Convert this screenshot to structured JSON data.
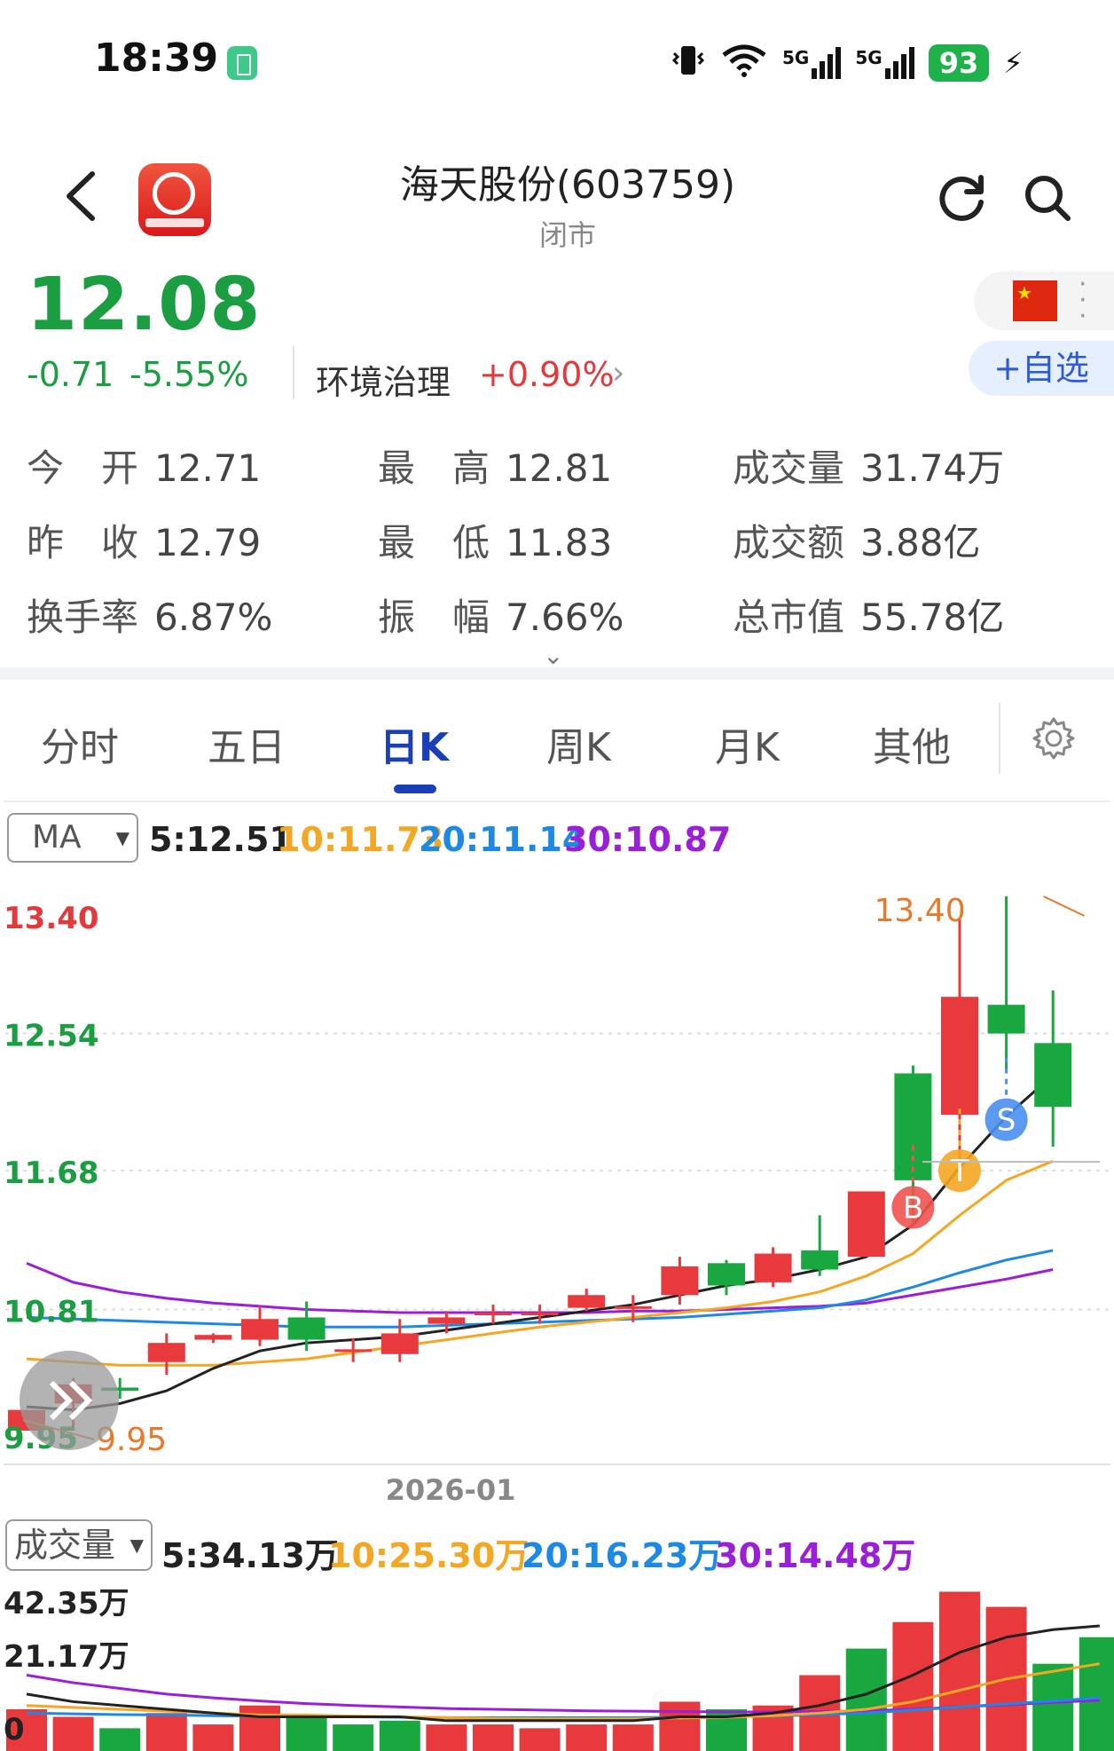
{
  "status_bar": {
    "time": "18:39",
    "battery": "93",
    "signal1": "5G",
    "signal2": "5G"
  },
  "header": {
    "title": "海天股份(603759)",
    "market_status": "闭市"
  },
  "quote": {
    "price": "12.08",
    "change": "-0.71",
    "change_pct": "-5.55%",
    "sector": "环境治理",
    "sector_pct": "+0.90%",
    "add_watch": "+自选"
  },
  "stats": [
    {
      "label": "今　开",
      "value": "12.71"
    },
    {
      "label": "最　高",
      "value": "12.81"
    },
    {
      "label": "成交量",
      "value": "31.74万"
    },
    {
      "label": "昨　收",
      "value": "12.79"
    },
    {
      "label": "最　低",
      "value": "11.83"
    },
    {
      "label": "成交额",
      "value": "3.88亿"
    },
    {
      "label": "换手率",
      "value": "6.87%"
    },
    {
      "label": "振　幅",
      "value": "7.66%"
    },
    {
      "label": "总市值",
      "value": "55.78亿"
    }
  ],
  "tabs": [
    "分时",
    "五日",
    "日K",
    "周K",
    "月K",
    "其他"
  ],
  "active_tab": "日K",
  "ma_legend": {
    "selector": "MA",
    "ma5": "5:12.51",
    "ma10": "10:11.73",
    "ma20": "20:11.14",
    "ma30": "30:10.87"
  },
  "vol_legend": {
    "selector": "成交量",
    "ma5": "5:34.13万",
    "ma10": "10:25.30万",
    "ma20": "20:16.23万",
    "ma30": "30:14.48万"
  },
  "colors": {
    "up": "#e8393c",
    "down": "#18a83f",
    "ma5": "#222222",
    "ma10": "#f5a623",
    "ma20": "#1e88e5",
    "ma30": "#9b1fd8"
  },
  "chart_data": [
    {
      "type": "candlestick",
      "title": "",
      "y_axis_labels": [
        "13.40",
        "12.54",
        "11.68",
        "10.81",
        "9.95"
      ],
      "ylim": [
        9.95,
        13.4
      ],
      "x_label": "2026-01",
      "high_marker": "13.40",
      "low_marker": "9.95",
      "candles": [
        {
          "o": 10.05,
          "c": 10.18,
          "h": 10.18,
          "l": 10.05
        },
        {
          "o": 10.22,
          "c": 10.34,
          "h": 10.38,
          "l": 10.05
        },
        {
          "o": 10.32,
          "c": 10.3,
          "h": 10.38,
          "l": 10.25
        },
        {
          "o": 10.48,
          "c": 10.6,
          "h": 10.66,
          "l": 10.4
        },
        {
          "o": 10.62,
          "c": 10.65,
          "h": 10.66,
          "l": 10.6
        },
        {
          "o": 10.62,
          "c": 10.75,
          "h": 10.83,
          "l": 10.58
        },
        {
          "o": 10.76,
          "c": 10.62,
          "h": 10.86,
          "l": 10.55
        },
        {
          "o": 10.56,
          "c": 10.56,
          "h": 10.63,
          "l": 10.48
        },
        {
          "o": 10.53,
          "c": 10.66,
          "h": 10.75,
          "l": 10.48
        },
        {
          "o": 10.72,
          "c": 10.76,
          "h": 10.8,
          "l": 10.66
        },
        {
          "o": 10.79,
          "c": 10.79,
          "h": 10.84,
          "l": 10.72
        },
        {
          "o": 10.79,
          "c": 10.79,
          "h": 10.84,
          "l": 10.72
        },
        {
          "o": 10.82,
          "c": 10.9,
          "h": 10.94,
          "l": 10.8
        },
        {
          "o": 10.83,
          "c": 10.83,
          "h": 10.9,
          "l": 10.73
        },
        {
          "o": 10.9,
          "c": 11.08,
          "h": 11.14,
          "l": 10.84
        },
        {
          "o": 11.1,
          "c": 10.96,
          "h": 11.12,
          "l": 10.9
        },
        {
          "o": 10.98,
          "c": 11.16,
          "h": 11.2,
          "l": 10.95
        },
        {
          "o": 11.18,
          "c": 11.06,
          "h": 11.4,
          "l": 11.02
        },
        {
          "o": 11.14,
          "c": 11.55,
          "h": 11.55,
          "l": 11.14
        },
        {
          "o": 12.29,
          "c": 11.62,
          "h": 12.34,
          "l": 11.34
        },
        {
          "o": 12.03,
          "c": 12.77,
          "h": 13.26,
          "l": 11.68
        },
        {
          "o": 12.72,
          "c": 12.54,
          "h": 13.4,
          "l": 12.3
        },
        {
          "o": 12.48,
          "c": 12.08,
          "h": 12.81,
          "l": 11.83
        }
      ],
      "ma5": [
        10.2,
        10.18,
        10.22,
        10.3,
        10.44,
        10.55,
        10.6,
        10.62,
        10.64,
        10.68,
        10.72,
        10.76,
        10.8,
        10.84,
        10.9,
        10.96,
        11.0,
        11.06,
        11.14,
        11.34,
        11.7,
        12.02,
        12.28
      ],
      "ma10": [
        10.5,
        10.48,
        10.46,
        10.46,
        10.46,
        10.48,
        10.5,
        10.54,
        10.58,
        10.62,
        10.66,
        10.7,
        10.73,
        10.76,
        10.79,
        10.82,
        10.86,
        10.92,
        11.02,
        11.16,
        11.4,
        11.62,
        11.74
      ],
      "ma20": [
        10.76,
        10.75,
        10.74,
        10.73,
        10.72,
        10.71,
        10.7,
        10.7,
        10.7,
        10.71,
        10.72,
        10.73,
        10.74,
        10.75,
        10.76,
        10.78,
        10.8,
        10.82,
        10.87,
        10.95,
        11.04,
        11.12,
        11.18
      ],
      "ma30": [
        11.1,
        10.98,
        10.92,
        10.88,
        10.85,
        10.83,
        10.81,
        10.8,
        10.79,
        10.79,
        10.79,
        10.79,
        10.79,
        10.8,
        10.8,
        10.81,
        10.82,
        10.83,
        10.85,
        10.9,
        10.95,
        11.0,
        11.06
      ],
      "signals": [
        {
          "label": "B",
          "candle": 19,
          "value": 11.45,
          "color": "#ef5350"
        },
        {
          "label": "T",
          "candle": 20,
          "value": 11.68,
          "color": "#f5a623"
        },
        {
          "label": "S",
          "candle": 21,
          "value": 12.0,
          "color": "#4a8ef0"
        }
      ]
    },
    {
      "type": "bar",
      "title": "成交量",
      "y_axis_labels": [
        "42.35万",
        "21.17万",
        "0"
      ],
      "ylim": [
        0,
        42.35
      ],
      "unit": "万",
      "values": [
        11,
        9,
        6,
        10,
        7,
        12,
        9,
        7,
        8,
        7,
        7,
        6,
        7,
        7,
        13,
        11,
        12,
        20,
        27,
        34,
        42,
        38,
        23,
        30
      ],
      "direction": [
        "up",
        "up",
        "down",
        "up",
        "up",
        "up",
        "down",
        "down",
        "down",
        "up",
        "up",
        "up",
        "up",
        "up",
        "up",
        "down",
        "up",
        "up",
        "down",
        "up",
        "up",
        "up",
        "down",
        "down"
      ],
      "ma5": [
        15,
        13,
        12,
        11,
        10,
        9,
        9,
        9,
        9,
        8,
        8,
        8,
        8,
        8,
        9,
        9,
        10,
        12,
        15,
        20,
        26,
        30,
        32,
        33
      ],
      "ma10": [
        12,
        11.5,
        11,
        10.5,
        10,
        9.5,
        9.5,
        9.2,
        9,
        8.8,
        8.6,
        8.5,
        8.5,
        8.5,
        8.7,
        8.9,
        9.3,
        10,
        11,
        13,
        16,
        19,
        21,
        23
      ],
      "ma20": [
        10,
        9.8,
        9.6,
        9.5,
        9.3,
        9.2,
        9.1,
        9,
        8.9,
        8.8,
        8.8,
        8.8,
        8.8,
        8.8,
        8.9,
        9,
        9.2,
        9.6,
        10,
        10.8,
        11.6,
        12.4,
        13.2,
        14
      ],
      "ma30": [
        20,
        18,
        16.5,
        15,
        14,
        13.2,
        12.5,
        12,
        11.6,
        11.2,
        11,
        10.8,
        10.6,
        10.5,
        10.4,
        10.3,
        10.3,
        10.4,
        10.6,
        11,
        11.6,
        12.2,
        12.8,
        13.4
      ]
    }
  ]
}
